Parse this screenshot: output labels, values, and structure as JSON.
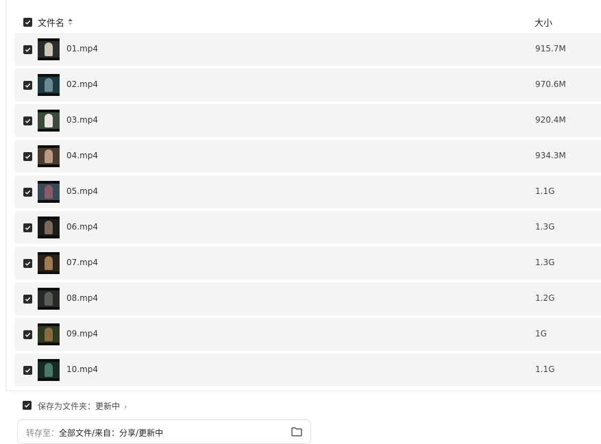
{
  "header": {
    "name_label": "文件名",
    "size_label": "大小",
    "select_all_checked": true
  },
  "files": [
    {
      "name": "01.mp4",
      "size": "915.7M",
      "checked": true,
      "thumb_colors": [
        "#2b2f2c",
        "#cfc7b8"
      ]
    },
    {
      "name": "02.mp4",
      "size": "970.6M",
      "checked": true,
      "thumb_colors": [
        "#1d3a44",
        "#6b8a8e"
      ]
    },
    {
      "name": "03.mp4",
      "size": "920.4M",
      "checked": true,
      "thumb_colors": [
        "#3c4a3a",
        "#e8e4dc"
      ]
    },
    {
      "name": "04.mp4",
      "size": "934.3M",
      "checked": true,
      "thumb_colors": [
        "#4a3a30",
        "#b89a80"
      ]
    },
    {
      "name": "05.mp4",
      "size": "1.1G",
      "checked": true,
      "thumb_colors": [
        "#3a4a55",
        "#8a5a6a"
      ]
    },
    {
      "name": "06.mp4",
      "size": "1.3G",
      "checked": true,
      "thumb_colors": [
        "#1c1a18",
        "#7a6a5a"
      ]
    },
    {
      "name": "07.mp4",
      "size": "1.3G",
      "checked": true,
      "thumb_colors": [
        "#2a221a",
        "#a07a50"
      ]
    },
    {
      "name": "08.mp4",
      "size": "1.2G",
      "checked": true,
      "thumb_colors": [
        "#262a28",
        "#5a5e58"
      ]
    },
    {
      "name": "09.mp4",
      "size": "1G",
      "checked": true,
      "thumb_colors": [
        "#2d3a1e",
        "#8a6a40"
      ]
    },
    {
      "name": "10.mp4",
      "size": "1.1G",
      "checked": true,
      "thumb_colors": [
        "#1a2a26",
        "#4a7a6a"
      ]
    }
  ],
  "footer": {
    "save_as_folder_label": "保存为文件夹：",
    "save_as_folder_value": "更新中",
    "save_as_folder_checked": true,
    "chevron": "›",
    "transfer_label": "转存至：",
    "transfer_value": "全部文件/来自：分享/更新中"
  },
  "colors": {
    "checkbox": "#2a2a2d",
    "row_background": "#f4f4f5"
  },
  "icons": {
    "sort": "sort-icon",
    "folder": "folder-icon",
    "check": "check-icon"
  }
}
